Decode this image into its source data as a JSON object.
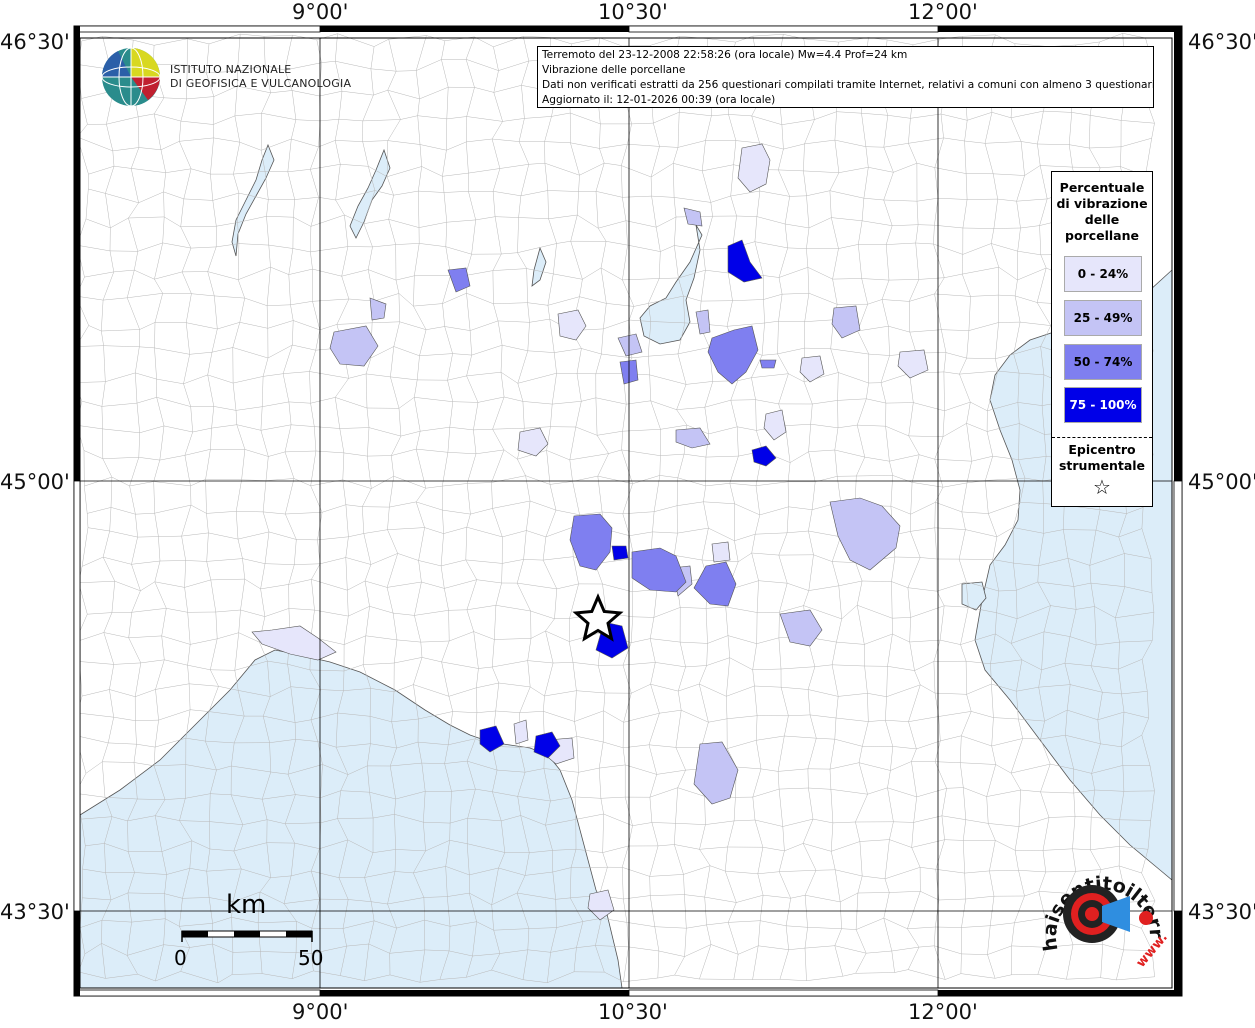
{
  "title_box": {
    "line1": "Terremoto del 23-12-2008 22:58:26 (ora locale) Mw=4.4 Prof=24 km",
    "line2": "Vibrazione delle porcellane",
    "line3": "Dati non verificati estratti da 256 questionari compilati tramite Internet, relativi a comuni con almeno 3 questionari.",
    "line4": "Aggiornato il: 12-01-2026 00:39 (ora locale)"
  },
  "logo_ingv": {
    "line1": "ISTITUTO NAZIONALE",
    "line2": "DI GEOFISICA E VULCANOLOGIA"
  },
  "logo_haisentito": {
    "text": "haisentitoilterremoto.it",
    "url_text": "www."
  },
  "lon_labels": [
    "9°00'",
    "10°30'",
    "12°00'"
  ],
  "lat_labels": [
    "46°30'",
    "45°00'",
    "43°30'"
  ],
  "legend": {
    "title": "Percentuale di vibrazione delle porcellane",
    "classes": [
      {
        "label": "0 - 24%",
        "color": "#e6e6fb"
      },
      {
        "label": "25 - 49%",
        "color": "#c4c4f5"
      },
      {
        "label": "50 - 74%",
        "color": "#7f7ff0"
      },
      {
        "label": "75 - 100%",
        "color": "#0000e8"
      }
    ],
    "epicenter_title": "Epicentro strumentale",
    "epicenter_symbol": "☆"
  },
  "scale_bar": {
    "unit": "km",
    "start": "0",
    "end": "50"
  },
  "colors": {
    "sea": "#dcedf9",
    "land": "#ffffff",
    "grid": "#000000"
  }
}
